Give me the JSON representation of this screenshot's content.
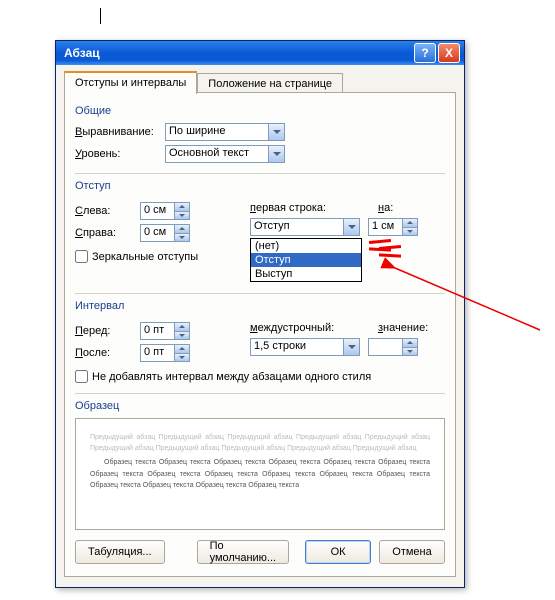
{
  "title": "Абзац",
  "tabs": {
    "active": "Отступы и интервалы",
    "inactive": "Положение на странице"
  },
  "general": {
    "group": "Общие",
    "align_label": "Выравнивание:",
    "align_value": "По ширине",
    "level_label": "Уровень:",
    "level_value": "Основной текст"
  },
  "indent": {
    "group": "Отступ",
    "left_label": "Слева:",
    "left_value": "0 см",
    "right_label": "Справа:",
    "right_value": "0 см",
    "mirror_label": "Зеркальные отступы",
    "firstline_label": "первая строка:",
    "firstline_value": "Отступ",
    "by_label": "на:",
    "by_value": "1 см",
    "options": [
      "(нет)",
      "Отступ",
      "Выступ"
    ]
  },
  "spacing": {
    "group": "Интервал",
    "before_label": "Перед:",
    "before_value": "0 пт",
    "after_label": "После:",
    "after_value": "0 пт",
    "line_label": "междустрочный:",
    "line_value": "1,5 строки",
    "at_label": "значение:",
    "at_value": "",
    "noadd_label": "Не добавлять интервал между абзацами одного стиля"
  },
  "preview": {
    "group": "Образец",
    "prev_line": "Предыдущий абзац Предыдущий абзац Предыдущий абзац Предыдущий абзац Предыдущий абзац Предыдущий абзац Предыдущий абзац Предыдущий абзац Предыдущий абзац Предыдущий абзац",
    "sample_line": "Образец текста Образец текста Образец текста Образец текста Образец текста Образец текста Образец текста Образец текста Образец текста Образец текста Образец текста Образец текста Образец текста Образец текста Образец текста Образец текста"
  },
  "buttons": {
    "tabs": "Табуляция...",
    "default": "По умолчанию...",
    "ok": "ОК",
    "cancel": "Отмена"
  }
}
